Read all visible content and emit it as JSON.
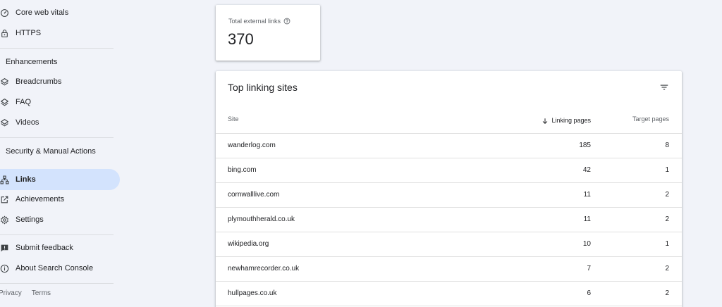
{
  "sidebar": {
    "items_top": [
      {
        "label": "Core web vitals",
        "icon": "gauge-icon"
      },
      {
        "label": "HTTPS",
        "icon": "lock-icon"
      }
    ],
    "enhancements_header": "Enhancements",
    "enhancements": [
      {
        "label": "Breadcrumbs",
        "icon": "layers-icon"
      },
      {
        "label": "FAQ",
        "icon": "layers-icon"
      },
      {
        "label": "Videos",
        "icon": "layers-icon"
      }
    ],
    "security_header": "Security & Manual Actions",
    "items_main": [
      {
        "label": "Links",
        "icon": "sitemap-icon",
        "active": true
      },
      {
        "label": "Achievements",
        "icon": "external-link-icon"
      },
      {
        "label": "Settings",
        "icon": "gear-icon"
      }
    ],
    "items_bottom": [
      {
        "label": "Submit feedback",
        "icon": "feedback-icon"
      },
      {
        "label": "About Search Console",
        "icon": "info-icon"
      }
    ],
    "footer": {
      "privacy": "Privacy",
      "terms": "Terms"
    }
  },
  "summary": {
    "label": "Total external links",
    "value": "370"
  },
  "table": {
    "title": "Top linking sites",
    "columns": {
      "site": "Site",
      "linking": "Linking pages",
      "target": "Target pages"
    },
    "sort_column": "linking",
    "rows": [
      {
        "site": "wanderlog.com",
        "linking": "185",
        "target": "8"
      },
      {
        "site": "bing.com",
        "linking": "42",
        "target": "1"
      },
      {
        "site": "cornwalllive.com",
        "linking": "11",
        "target": "2"
      },
      {
        "site": "plymouthherald.co.uk",
        "linking": "11",
        "target": "2"
      },
      {
        "site": "wikipedia.org",
        "linking": "10",
        "target": "1"
      },
      {
        "site": "newhamrecorder.co.uk",
        "linking": "7",
        "target": "2"
      },
      {
        "site": "hullpages.co.uk",
        "linking": "6",
        "target": "2"
      }
    ]
  },
  "colors": {
    "background": "#f1f3f9",
    "active_nav": "#d3e3fd",
    "card": "#ffffff"
  }
}
